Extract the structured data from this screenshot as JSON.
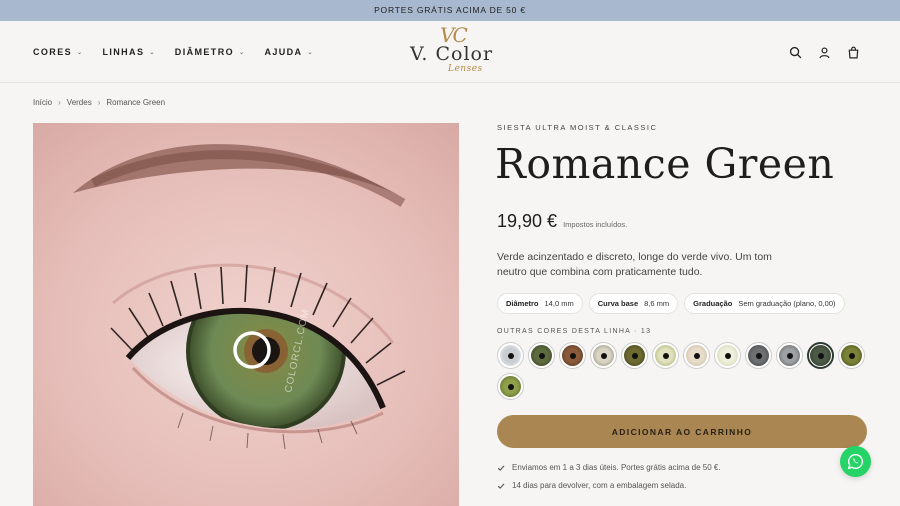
{
  "announcement": "PORTES GRÁTIS ACIMA DE 50 €",
  "nav": [
    {
      "label": "CORES"
    },
    {
      "label": "LINHAS"
    },
    {
      "label": "DIÂMETRO"
    },
    {
      "label": "AJUDA"
    }
  ],
  "logo": {
    "monogram": "VC",
    "main": "V. Color",
    "sub": "Lenses"
  },
  "header_icons": [
    "search-icon",
    "account-icon",
    "cart-icon"
  ],
  "breadcrumb": {
    "home": "Início",
    "category": "Verdes",
    "current": "Romance Green",
    "separator": "›"
  },
  "product": {
    "brand_line": "SIESTA ULTRA MOIST & CLASSIC",
    "title": "Romance Green",
    "price": "19,90 €",
    "tax_note": "Impostos incluídos.",
    "description": "Verde acinzentado e discreto, longe do verde vivo. Um tom neutro que combina com praticamente tudo.",
    "specs": [
      {
        "key": "Diâmetro",
        "value": "14,0 mm"
      },
      {
        "key": "Curva base",
        "value": "8,6 mm"
      },
      {
        "key": "Graduação",
        "value": "Sem graduação (plano, 0,00)"
      }
    ],
    "colors_label": "OUTRAS CORES DESTA LINHA · 13",
    "swatches": [
      {
        "color": "#c9cdd2",
        "ring": "#eef0f2"
      },
      {
        "color": "#5d6b3e",
        "ring": "#2f3a1e"
      },
      {
        "color": "#8a5a3a",
        "ring": "#4a2e1c"
      },
      {
        "color": "#d9d4c4",
        "ring": "#8c8670"
      },
      {
        "color": "#6d6a32",
        "ring": "#3b391a"
      },
      {
        "color": "#dfe2bd",
        "ring": "#a5a96a"
      },
      {
        "color": "#e8dccb",
        "ring": "#c9b79c"
      },
      {
        "color": "#eef0dc",
        "ring": "#c8cba6"
      },
      {
        "color": "#6d6f70",
        "ring": "#3a3b3c"
      },
      {
        "color": "#9ea1a3",
        "ring": "#55585a"
      },
      {
        "color": "#4e5a48",
        "ring": "#28301f"
      },
      {
        "color": "#7a8238",
        "ring": "#434a1a"
      },
      {
        "color": "#8fa04a",
        "ring": "#4e5c22"
      }
    ],
    "active_swatch": 10,
    "cart_button": "ADICIONAR AO CARRINHO",
    "perks": [
      "Enviamos em 1 a 3 dias úteis. Portes grátis acima de 50 €.",
      "14 dias para devolver, com a embalagem selada."
    ]
  },
  "photo_watermark": "COLORCL.COM",
  "accent_colors": {
    "button": "#a98652",
    "announcement": "#a8b8cf",
    "whatsapp": "#25d366"
  }
}
